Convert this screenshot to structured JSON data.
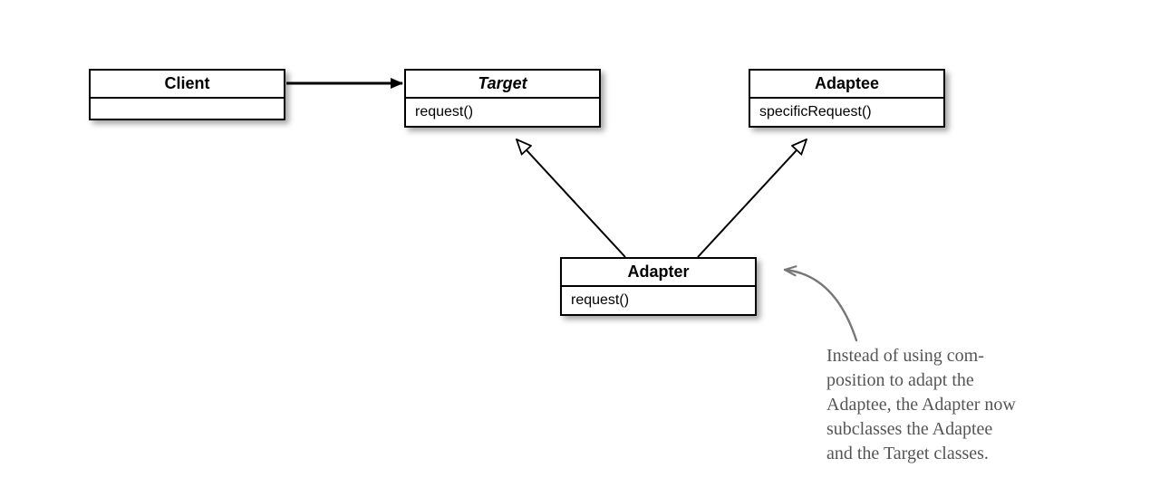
{
  "diagram": {
    "client": {
      "title": "Client",
      "body": ""
    },
    "target": {
      "title": "Target",
      "body": "request()"
    },
    "adaptee": {
      "title": "Adaptee",
      "body": "specificRequest()"
    },
    "adapter": {
      "title": "Adapter",
      "body": "request()"
    }
  },
  "annotation": {
    "text": "Instead of using com-\nposition to adapt the\nAdaptee, the Adapter now\nsubclasses the Adaptee\nand the Target classes."
  }
}
